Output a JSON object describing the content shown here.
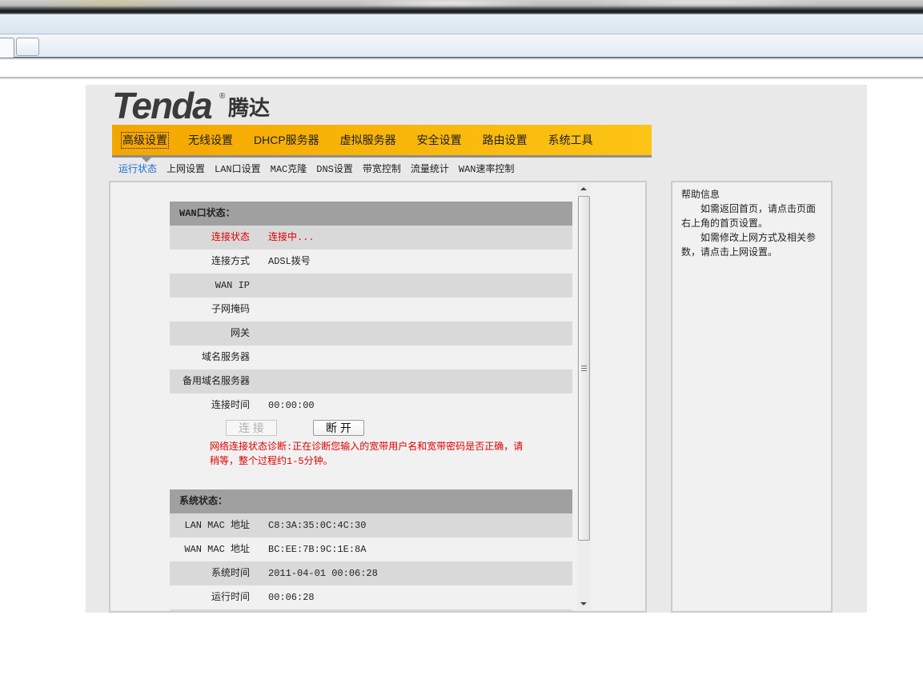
{
  "logo": {
    "brand": "Tenda",
    "registered_mark": "®",
    "brand_chinese": "腾达"
  },
  "nav": {
    "selected_index": 0,
    "items": [
      "高级设置",
      "无线设置",
      "DHCP服务器",
      "虚拟服务器",
      "安全设置",
      "路由设置",
      "系统工具"
    ]
  },
  "subnav": {
    "selected_index": 0,
    "items": [
      "运行状态",
      "上网设置",
      "LAN口设置",
      "MAC克隆",
      "DNS设置",
      "带宽控制",
      "流量统计",
      "WAN速率控制"
    ]
  },
  "wan_status": {
    "title": "WAN口状态：",
    "rows": [
      {
        "label": "连接状态",
        "value": "连接中...",
        "alert": true
      },
      {
        "label": "连接方式",
        "value": "ADSL拨号"
      },
      {
        "label": "WAN IP",
        "value": ""
      },
      {
        "label": "子网掩码",
        "value": ""
      },
      {
        "label": "网关",
        "value": ""
      },
      {
        "label": "域名服务器",
        "value": ""
      },
      {
        "label": "备用域名服务器",
        "value": ""
      },
      {
        "label": "连接时间",
        "value": "00:00:00"
      }
    ],
    "connect_button": {
      "label": "连 接",
      "enabled": false
    },
    "disconnect_button": {
      "label": "断 开",
      "enabled": true
    },
    "diagnostic_lines": [
      "网络连接状态诊断:正在诊断您输入的宽带用户名和宽带密码是否正确，请",
      "稍等，整个过程约1-5分钟。"
    ]
  },
  "system_status": {
    "title": "系统状态：",
    "rows": [
      {
        "label": "LAN MAC 地址",
        "value": "C8:3A:35:0C:4C:30"
      },
      {
        "label": "WAN MAC 地址",
        "value": "BC:EE:7B:9C:1E:8A"
      },
      {
        "label": "系统时间",
        "value": "2011-04-01 00:06:28"
      },
      {
        "label": "运行时间",
        "value": "00:06:28"
      }
    ]
  },
  "help": {
    "title": "帮助信息",
    "paragraphs": [
      [
        "如需返回首页，请点击页面",
        "右上角的首页设置。"
      ],
      [
        "如需修改上网方式及相关参",
        "数，请点击上网设置。"
      ]
    ]
  },
  "colors": {
    "nav_orange": "#f4a600",
    "nav_yellow": "#fcc414",
    "selected_blue": "#1c6ed6",
    "alert_red": "#e00000",
    "header_gray": "#a0a0a0",
    "row_gray": "#d9d9d9"
  }
}
